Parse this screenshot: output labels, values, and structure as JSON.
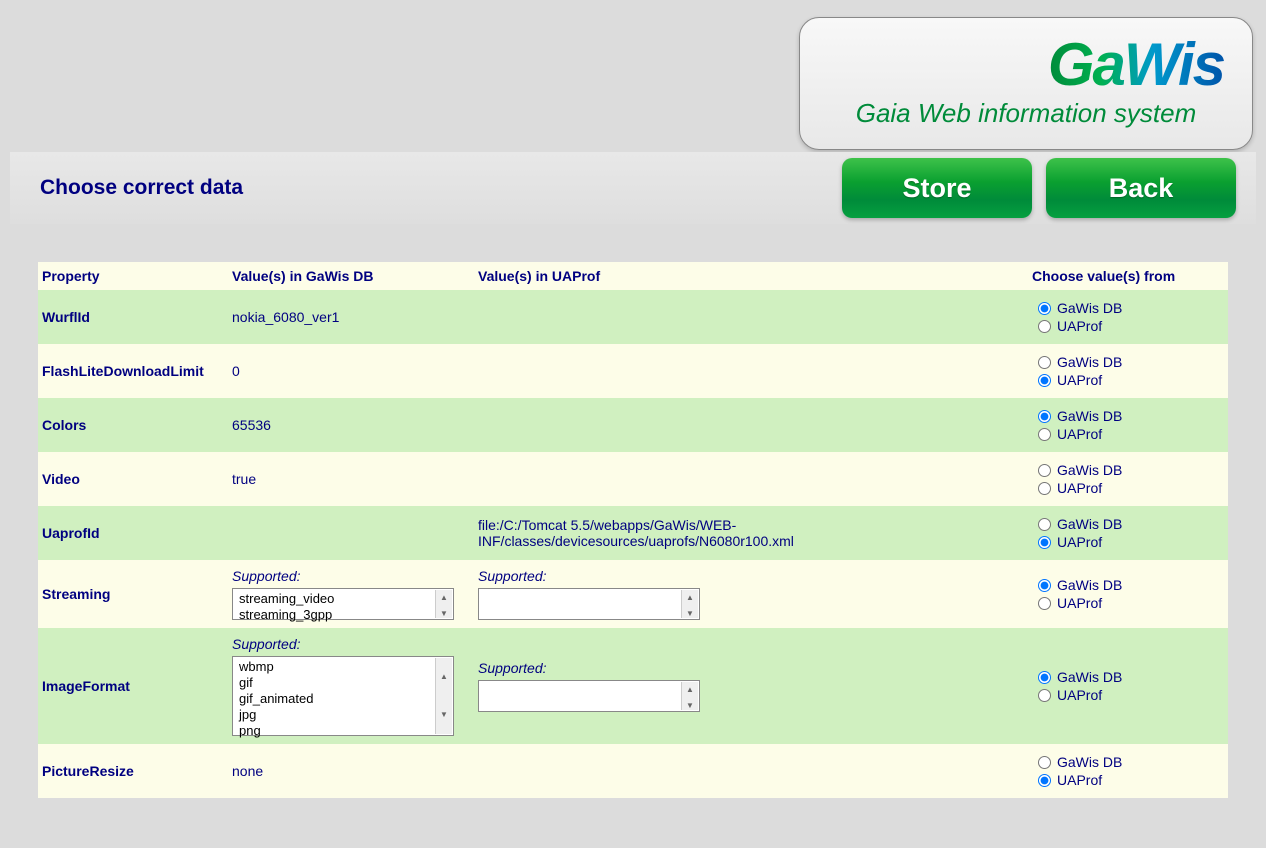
{
  "logo": {
    "main": "GaWis",
    "sub": "Gaia Web information system"
  },
  "header": {
    "title": "Choose correct data",
    "store_label": "Store",
    "back_label": "Back"
  },
  "columns": {
    "property": "Property",
    "gawis": "Value(s) in GaWis DB",
    "uaprof": "Value(s) in UAProf",
    "choose": "Choose value(s) from"
  },
  "choice_labels": {
    "gawis": "GaWis DB",
    "uaprof": "UAProf"
  },
  "supported_label": "Supported:",
  "rows": [
    {
      "property": "WurflId",
      "gawis_value": "nokia_6080_ver1",
      "uaprof_value": "",
      "choice": "gawis",
      "type": "plain"
    },
    {
      "property": "FlashLiteDownloadLimit",
      "gawis_value": "0",
      "uaprof_value": "",
      "choice": "uaprof",
      "type": "plain"
    },
    {
      "property": "Colors",
      "gawis_value": "65536",
      "uaprof_value": "",
      "choice": "gawis",
      "type": "plain"
    },
    {
      "property": "Video",
      "gawis_value": "true",
      "uaprof_value": "",
      "choice": "none",
      "type": "plain"
    },
    {
      "property": "UaprofId",
      "gawis_value": "",
      "uaprof_value": "file:/C:/Tomcat 5.5/webapps/GaWis/WEB-INF/classes/devicesources/uaprofs/N6080r100.xml",
      "choice": "uaprof",
      "type": "plain"
    },
    {
      "property": "Streaming",
      "gawis_items": [
        "streaming_video",
        "streaming_3gpp"
      ],
      "uaprof_items": [],
      "choice": "gawis",
      "type": "list-short"
    },
    {
      "property": "ImageFormat",
      "gawis_items": [
        "wbmp",
        "gif",
        "gif_animated",
        "jpg",
        "png"
      ],
      "uaprof_items": [],
      "choice": "gawis",
      "type": "list-tall"
    },
    {
      "property": "PictureResize",
      "gawis_value": "none",
      "uaprof_value": "",
      "choice": "uaprof",
      "type": "plain"
    }
  ]
}
